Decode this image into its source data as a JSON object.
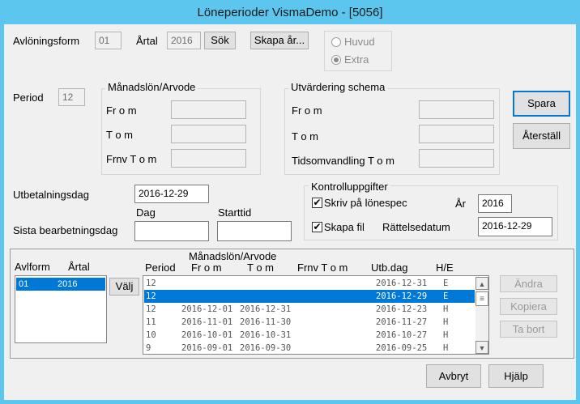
{
  "window": {
    "title": "Löneperioder VismaDemo - [5056]"
  },
  "top": {
    "avloningsform_label": "Avlöningsform",
    "avloningsform_value": "01",
    "artal_label": "Årtal",
    "artal_value": "2016",
    "sok_button": "Sök",
    "skapa_ar_button": "Skapa år...",
    "radio_huvud": "Huvud",
    "radio_extra": "Extra",
    "selected_radio": "Extra"
  },
  "period": {
    "label": "Period",
    "value": "12"
  },
  "manadslon": {
    "title": "Månadslön/Arvode",
    "from_label": "Fr o m",
    "tom_label": "T o m",
    "frnv_label": "Frnv T o m",
    "from_value": "",
    "tom_value": "",
    "frnv_value": ""
  },
  "utvardering": {
    "title": "Utvärdering schema",
    "from_label": "Fr o m",
    "tom_label": "T o m",
    "tidsomv_label": "Tidsomvandling T o m",
    "from_value": "",
    "tom_value": "",
    "tidsomv_value": ""
  },
  "actions": {
    "spara": "Spara",
    "aterstall": "Återställ"
  },
  "utbetalning": {
    "label": "Utbetalningsdag",
    "value": "2016-12-29"
  },
  "sista": {
    "label": "Sista bearbetningsdag",
    "dag_label": "Dag",
    "starttid_label": "Starttid",
    "dag_value": "",
    "starttid_value": ""
  },
  "kontroll": {
    "title": "Kontrolluppgifter",
    "skriv_label": "Skriv på lönespec",
    "skriv_checked": true,
    "skapa_fil_label": "Skapa fil",
    "skapa_fil_checked": true,
    "ar_label": "År",
    "ar_value": "2016",
    "rattelse_label": "Rättelsedatum",
    "rattelse_value": "2016-12-29"
  },
  "left_list": {
    "headers": [
      "Avlform",
      "Årtal"
    ],
    "rows": [
      {
        "avlform": "01",
        "artal": "2016",
        "selected": true
      }
    ],
    "valj_button": "Välj"
  },
  "period_list": {
    "group_header": "Månadslön/Arvode",
    "headers": [
      "Period",
      "Fr o m",
      "T o m",
      "Frnv T o m",
      "Utb.dag",
      "H/E"
    ],
    "rows": [
      {
        "period": "12",
        "from": "",
        "tom": "",
        "frnv": "",
        "utbdag": "2016-12-31",
        "he": "E",
        "selected": false
      },
      {
        "period": "12",
        "from": "",
        "tom": "",
        "frnv": "",
        "utbdag": "2016-12-29",
        "he": "E",
        "selected": true
      },
      {
        "period": "12",
        "from": "2016-12-01",
        "tom": "2016-12-31",
        "frnv": "",
        "utbdag": "2016-12-23",
        "he": "H",
        "selected": false
      },
      {
        "period": "11",
        "from": "2016-11-01",
        "tom": "2016-11-30",
        "frnv": "",
        "utbdag": "2016-11-27",
        "he": "H",
        "selected": false
      },
      {
        "period": "10",
        "from": "2016-10-01",
        "tom": "2016-10-31",
        "frnv": "",
        "utbdag": "2016-10-27",
        "he": "H",
        "selected": false
      },
      {
        "period": "9",
        "from": "2016-09-01",
        "tom": "2016-09-30",
        "frnv": "",
        "utbdag": "2016-09-25",
        "he": "H",
        "selected": false
      }
    ]
  },
  "side_buttons": {
    "andra": "Ändra",
    "kopiera": "Kopiera",
    "ta_bort": "Ta bort"
  },
  "bottom": {
    "avbryt": "Avbryt",
    "hjalp": "Hjälp"
  },
  "colors": {
    "titlebar": "#5cc6ef",
    "selection": "#0078d7",
    "dialog": "#f0f0f0"
  },
  "icons": {
    "scroll_up": "chevron-up-icon",
    "scroll_down": "chevron-down-icon",
    "check": "checkmark-icon"
  }
}
